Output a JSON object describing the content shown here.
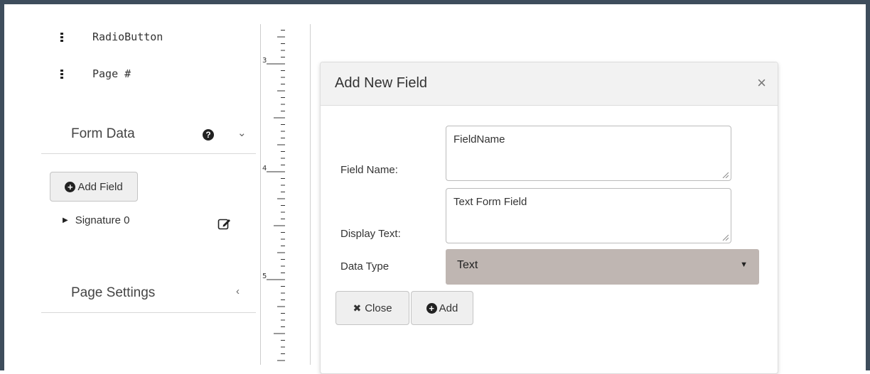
{
  "toolbox": {
    "items": [
      {
        "label": "RadioButton",
        "icon": "drag-handle-icon"
      },
      {
        "label": "Page #",
        "icon": "drag-handle-icon"
      }
    ]
  },
  "form_data": {
    "title": "Form Data",
    "help_icon": "question-circle-icon",
    "chevron": "⌄",
    "add_field_label": "Add Field",
    "fields": [
      {
        "label": "Signature 0",
        "icon": "edit-icon"
      }
    ]
  },
  "page_settings": {
    "title": "Page Settings",
    "chevron": "‹"
  },
  "ruler": {
    "labels": [
      "3",
      "4",
      "5"
    ]
  },
  "dialog": {
    "title": "Add New Field",
    "close_glyph": "×",
    "field_name_label": "Field Name:",
    "field_name_value": "FieldName",
    "display_text_label": "Display Text:",
    "display_text_value": "Text Form Field",
    "data_type_label": "Data Type",
    "data_type_selected": "Text",
    "close_button_label": "Close",
    "add_button_label": "Add"
  },
  "colors": {
    "frame": "#3e4d5c",
    "select_bg": "#bfb6b2",
    "button_bg": "#efefef"
  }
}
